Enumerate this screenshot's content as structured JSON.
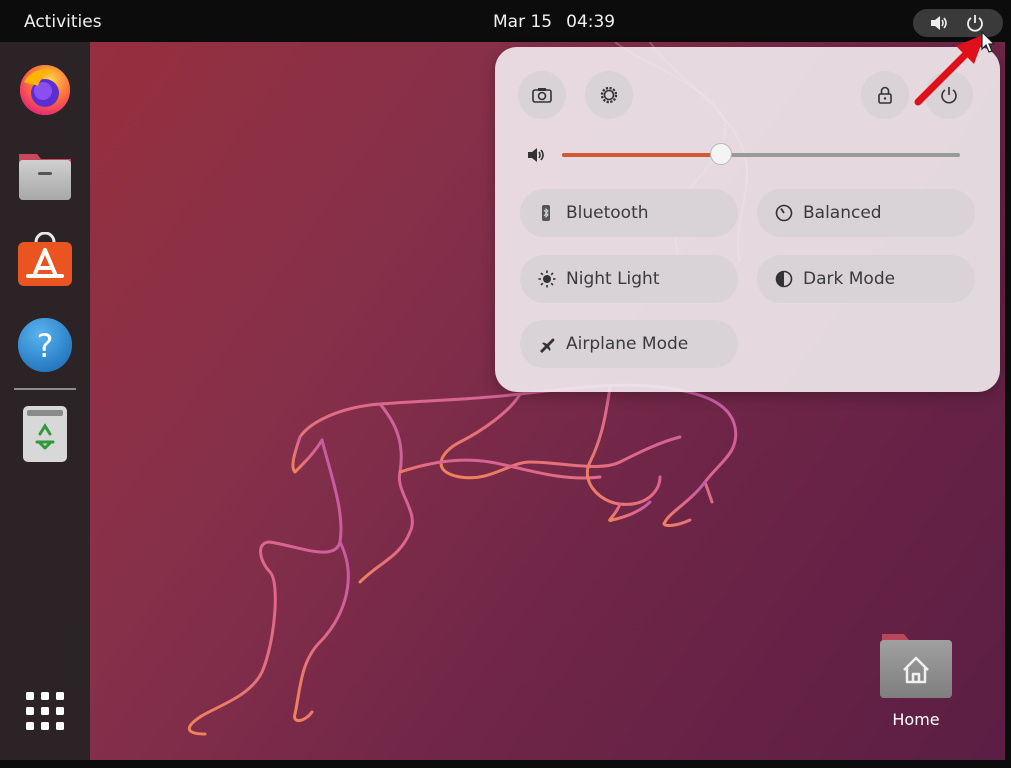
{
  "topbar": {
    "activities_label": "Activities",
    "date": "Mar 15",
    "time": "04:39"
  },
  "dock": {
    "items": [
      "Firefox",
      "Files",
      "Ubuntu Software",
      "Help",
      "Trash"
    ]
  },
  "desktop": {
    "home_label": "Home"
  },
  "quick_settings": {
    "volume_level": 0.4,
    "toggles": {
      "bluetooth": "Bluetooth",
      "power_mode": "Balanced",
      "night_light": "Night Light",
      "dark_mode": "Dark Mode",
      "airplane_mode": "Airplane Mode"
    }
  },
  "colors": {
    "accent": "#d15a35",
    "annotation_arrow": "#e0101a"
  }
}
